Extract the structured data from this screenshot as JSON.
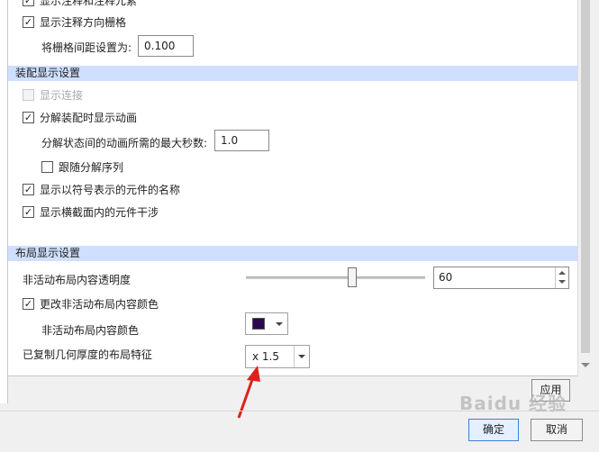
{
  "top": {
    "cut_checkbox_label": "显示注释和注释元素",
    "grid_direction_label": "显示注释方向栅格",
    "grid_spacing_label": "将栅格间距设置为:",
    "grid_spacing_value": "0.100"
  },
  "assembly": {
    "header": "装配显示设置",
    "show_connections_label": "显示连接",
    "explode_animation_label": "分解装配时显示动画",
    "max_seconds_label": "分解状态间的动画所需的最大秒数:",
    "max_seconds_value": "1.0",
    "follow_sequence_label": "跟随分解序列",
    "symbol_names_label": "显示以符号表示的元件的名称",
    "interference_label": "显示横截面内的元件干涉"
  },
  "layout": {
    "header": "布局显示设置",
    "transparency_label": "非活动布局内容透明度",
    "transparency_value": "60",
    "transparency_percent": 60,
    "change_color_label": "更改非活动布局内容颜色",
    "inactive_color_label": "非活动布局内容颜色",
    "inactive_color": "#2d0a4e",
    "thickness_label": "已复制几何厚度的布局特征",
    "thickness_value": "x 1.5"
  },
  "buttons": {
    "apply": "应用",
    "ok": "确定",
    "cancel": "取消"
  },
  "icons": {
    "checked": "✓"
  },
  "colors": {
    "header_bg": "#cfdfff",
    "annotation_arrow": "#e0201a"
  },
  "watermark": "Baidu 经验"
}
